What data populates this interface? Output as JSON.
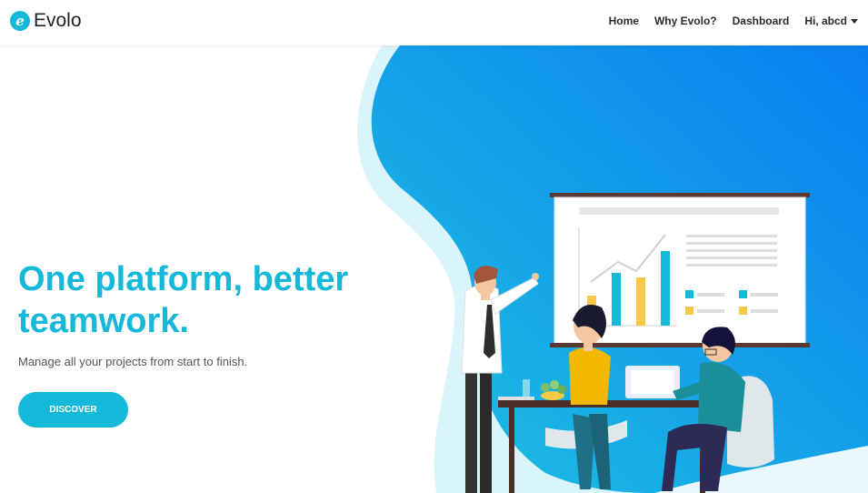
{
  "brand": {
    "logo_letter": "e",
    "name": "Evolo"
  },
  "nav": {
    "items": [
      {
        "label": "Home"
      },
      {
        "label": "Why Evolo?"
      },
      {
        "label": "Dashboard"
      },
      {
        "label": "Hi, abcd"
      }
    ]
  },
  "hero": {
    "headline_line1": "One platform, better",
    "headline_line2": "teamwork.",
    "subhead": "Manage all your projects from start to finish.",
    "cta_label": "DISCOVER"
  },
  "colors": {
    "accent": "#14b8d8",
    "blob_start": "#1ec3e0",
    "blob_end": "#0a7ff0"
  },
  "icons": [
    "logo-icon",
    "caret-down-icon"
  ]
}
